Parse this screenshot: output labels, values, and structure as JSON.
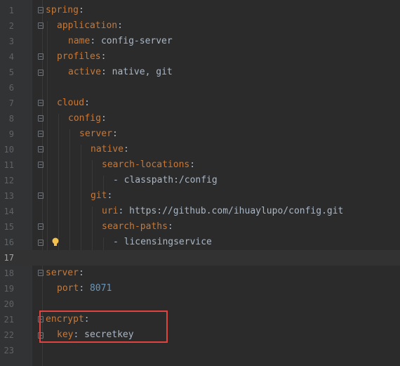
{
  "editor": {
    "lines": [
      {
        "num": "1",
        "key": "spring",
        "sep": ":",
        "value": ""
      },
      {
        "num": "2",
        "key": "application",
        "sep": ":",
        "value": ""
      },
      {
        "num": "3",
        "key": "name",
        "sep": ":",
        "value": " config-server"
      },
      {
        "num": "4",
        "key": "profiles",
        "sep": ":",
        "value": ""
      },
      {
        "num": "5",
        "key": "active",
        "sep": ":",
        "value": " native, git"
      },
      {
        "num": "6",
        "key": "",
        "sep": "",
        "value": ""
      },
      {
        "num": "7",
        "key": "cloud",
        "sep": ":",
        "value": ""
      },
      {
        "num": "8",
        "key": "config",
        "sep": ":",
        "value": ""
      },
      {
        "num": "9",
        "key": "server",
        "sep": ":",
        "value": ""
      },
      {
        "num": "10",
        "key": "native",
        "sep": ":",
        "value": ""
      },
      {
        "num": "11",
        "key": "search-locations",
        "sep": ":",
        "value": ""
      },
      {
        "num": "12",
        "key": "",
        "sep": "",
        "value": "- classpath:/config"
      },
      {
        "num": "13",
        "key": "git",
        "sep": ":",
        "value": ""
      },
      {
        "num": "14",
        "key": "uri",
        "sep": ":",
        "value": " https://github.com/ihuaylupo/config.git"
      },
      {
        "num": "15",
        "key": "search-paths",
        "sep": ":",
        "value": ""
      },
      {
        "num": "16",
        "key": "",
        "sep": "",
        "value": "- licensingservice"
      },
      {
        "num": "17",
        "key": "",
        "sep": "",
        "value": ""
      },
      {
        "num": "18",
        "key": "server",
        "sep": ":",
        "value": ""
      },
      {
        "num": "19",
        "key": "port",
        "sep": ":",
        "value": " 8071"
      },
      {
        "num": "20",
        "key": "",
        "sep": "",
        "value": ""
      },
      {
        "num": "21",
        "key": "encrypt",
        "sep": ":",
        "value": ""
      },
      {
        "num": "22",
        "key": "key",
        "sep": ":",
        "value": " secretkey"
      },
      {
        "num": "23",
        "key": "",
        "sep": "",
        "value": ""
      }
    ],
    "current_line": "17",
    "colors": {
      "background": "#2b2b2b",
      "key": "#cc7832",
      "text": "#a9b7c6",
      "number": "#6897bb",
      "highlight_box": "#e0443e",
      "intention_bulb": "#f2c14e"
    },
    "icons": [
      "fold-icon",
      "intention-bulb-icon"
    ]
  }
}
